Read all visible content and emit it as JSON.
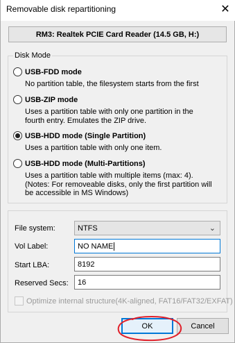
{
  "window": {
    "title": "Removable disk repartitioning",
    "close_glyph": "✕"
  },
  "device": {
    "label": "RM3: Realtek PCIE Card Reader (14.5 GB, H:)"
  },
  "disk_mode": {
    "title": "Disk Mode",
    "options": [
      {
        "label": "USB-FDD mode",
        "description": "No partition table, the filesystem starts from the first",
        "checked": false
      },
      {
        "label": "USB-ZIP mode",
        "description_lines": [
          "Uses a partition table with only one partition in the",
          "fourth entry. Emulates the ZIP drive."
        ],
        "checked": false
      },
      {
        "label": "USB-HDD mode (Single Partition)",
        "description": "Uses a partition table with only one item.",
        "checked": true
      },
      {
        "label": "USB-HDD mode (Multi-Partitions)",
        "description_lines": [
          "Uses a partition table with multiple items (max: 4).",
          "(Notes: For removeable disks, only the first partition will",
          "be accessible in MS Windows)"
        ],
        "checked": false
      }
    ]
  },
  "settings": {
    "file_system_label": "File system:",
    "file_system_value": "NTFS",
    "vol_label_label": "Vol Label:",
    "vol_label_value": "NO NAME",
    "start_lba_label": "Start LBA:",
    "start_lba_value": "8192",
    "reserved_secs_label": "Reserved Secs:",
    "reserved_secs_value": "16",
    "optimize_label": "Optimize internal structure(4K-aligned, FAT16/FAT32/EXFAT)",
    "optimize_checked": false,
    "optimize_enabled": false
  },
  "buttons": {
    "ok": "OK",
    "cancel": "Cancel"
  },
  "annotation": {
    "color": "#e0202a",
    "shape": "hand-drawn circle around OK button"
  },
  "colors": {
    "accent": "#0078d7",
    "window_bg": "#f0f0f0"
  }
}
